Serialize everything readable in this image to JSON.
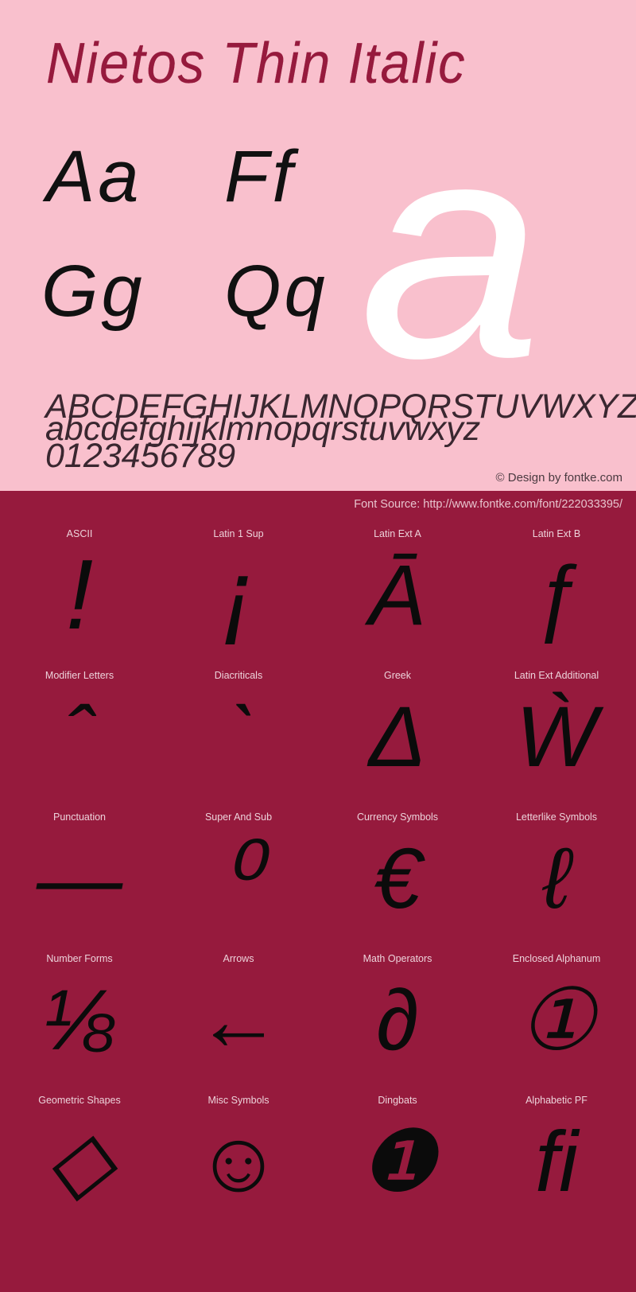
{
  "specimen": {
    "title": "Nietos Thin Italic",
    "big_glyph": "a",
    "sample_pairs": [
      {
        "name": "aa",
        "text": "Aa"
      },
      {
        "name": "ff",
        "text": "Ff"
      },
      {
        "name": "gg",
        "text": "Gg"
      },
      {
        "name": "qq",
        "text": "Qq"
      }
    ],
    "alphabet_upper": "ABCDEFGHIJKLMNOPQRSTUVWXYZ",
    "alphabet_lower": "abcdefghijklmnopqrstuvwxyz",
    "digits": "0123456789",
    "copyright": "© Design by fontke.com",
    "font_source": "Font Source: http://www.fontke.com/font/222033395/",
    "colors": {
      "pink_background": "#f9c0cd",
      "dark_background": "#961a3d",
      "title": "#961a3d",
      "glyph_black": "#0b0b0b",
      "big_glyph_white": "#ffffff",
      "label": "#edd2da"
    }
  },
  "unicode_blocks": [
    {
      "label": "ASCII",
      "glyph": "!",
      "size": "tall"
    },
    {
      "label": "Latin 1 Sup",
      "glyph": "¡",
      "size": "tall"
    },
    {
      "label": "Latin Ext A",
      "glyph": "Ā",
      "size": "normal"
    },
    {
      "label": "Latin Ext B",
      "glyph": "ƒ",
      "size": "normal"
    },
    {
      "label": "Modifier Letters",
      "glyph": "ˆ",
      "size": "normal"
    },
    {
      "label": "Diacriticals",
      "glyph": "ˋ",
      "size": "normal"
    },
    {
      "label": "Greek",
      "glyph": "Δ",
      "size": "normal"
    },
    {
      "label": "Latin Ext Additional",
      "glyph": "Ẁ",
      "size": "normal"
    },
    {
      "label": "Punctuation",
      "glyph": "—",
      "size": "normal"
    },
    {
      "label": "Super And Sub",
      "glyph": "⁰",
      "size": "tall"
    },
    {
      "label": "Currency Symbols",
      "glyph": "€",
      "size": "normal"
    },
    {
      "label": "Letterlike Symbols",
      "glyph": "ℓ",
      "size": "normal"
    },
    {
      "label": "Number Forms",
      "glyph": "⅛",
      "size": "normal"
    },
    {
      "label": "Arrows",
      "glyph": "←",
      "size": "normal"
    },
    {
      "label": "Math Operators",
      "glyph": "∂",
      "size": "normal"
    },
    {
      "label": "Enclosed Alphanum",
      "glyph": "①",
      "size": "normal"
    },
    {
      "label": "Geometric Shapes",
      "glyph": "◇",
      "size": "normal"
    },
    {
      "label": "Misc Symbols",
      "glyph": "☺",
      "size": "normal"
    },
    {
      "label": "Dingbats",
      "glyph": "❶",
      "size": "normal"
    },
    {
      "label": "Alphabetic PF",
      "glyph": "ﬁ",
      "size": "normal"
    }
  ]
}
